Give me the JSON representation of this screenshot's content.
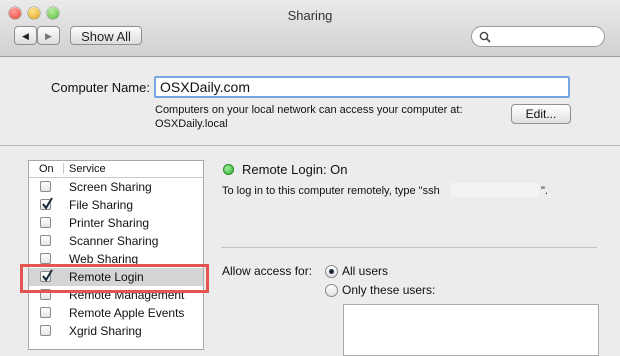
{
  "window": {
    "title": "Sharing"
  },
  "toolbar": {
    "back_forward_glyphs": [
      "◀",
      "▶"
    ],
    "show_all_label": "Show All",
    "search_placeholder": ""
  },
  "computer": {
    "name_label": "Computer Name:",
    "name_value": "OSXDaily.com",
    "info_line1": "Computers on your local network can access your computer at:",
    "info_line2": "OSXDaily.local",
    "edit_label": "Edit..."
  },
  "services": {
    "header_on": "On",
    "header_service": "Service",
    "items": [
      {
        "label": "Screen Sharing",
        "checked": false
      },
      {
        "label": "File Sharing",
        "checked": true
      },
      {
        "label": "Printer Sharing",
        "checked": false
      },
      {
        "label": "Scanner Sharing",
        "checked": false
      },
      {
        "label": "Web Sharing",
        "checked": false
      },
      {
        "label": "Remote Login",
        "checked": true,
        "selected": true
      },
      {
        "label": "Remote Management",
        "checked": false
      },
      {
        "label": "Remote Apple Events",
        "checked": false
      },
      {
        "label": "Xgrid Sharing",
        "checked": false
      }
    ]
  },
  "detail": {
    "status": "Remote Login: On",
    "status_color": "#2fae2c",
    "instructions_prefix": "To log in to this computer remotely, type \"ssh",
    "instructions_suffix": "\".",
    "access_label": "Allow access for:",
    "option_all": "All users",
    "option_some": "Only these users:",
    "selected_option": "All users"
  },
  "colors": {
    "highlight": "#e25550",
    "focus": "#76a6e0"
  }
}
